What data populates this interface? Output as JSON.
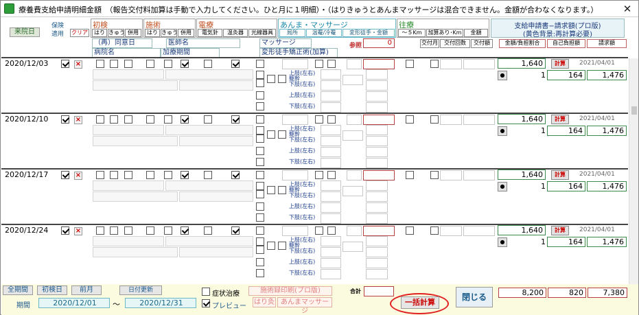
{
  "window": {
    "title": "療養費支給申請明細金額　（報告交付料加算は手動で入力してください。ひと月に１明細）・（はりきゅうとあんまマッサージは混合できません。金額が合わなくなります。）",
    "close": "✕",
    "icon": "app-icon"
  },
  "header": {
    "raiin_btn": "来院日",
    "hoken_lbl": "保険",
    "tekiyo_lbl": "適用",
    "clear_btn": "クリア",
    "shoken": {
      "title": "初検",
      "items": [
        "はり",
        "きゅう",
        "併用"
      ]
    },
    "seijutsu": {
      "title": "施術",
      "items": [
        "はり",
        "きゅう",
        "併用"
      ]
    },
    "denryo": {
      "title": "電療",
      "items": [
        "電気針",
        "温灸器",
        "光線器具"
      ]
    },
    "anma": {
      "title": "あんま・マッサージ",
      "items": [
        "局所",
        "温罨/冷罨",
        "変形徒手・金額"
      ]
    },
    "oushin": {
      "title": "往療",
      "items": [
        "～５Km",
        "加算あり･Km",
        "金額"
      ]
    },
    "shikyu": {
      "title": "支給申請書−請求額(プロ版)",
      "sub": "(黄色背景:再計算必要)"
    },
    "sub_row": {
      "sai": "（再）同意日",
      "ishi": "医師名",
      "massage": "マッサージ",
      "sanko": "参照",
      "sanko_val": "0",
      "kofu_tsuki": "交付月",
      "kofu_kaisu": "交付回数",
      "kofu_gaku": "交付額",
      "kingaku": "金額/負担割合",
      "jiko": "自己負担額",
      "seikyu": "請求額"
    },
    "third_row": {
      "byoin": "病院名",
      "kaso": "加療期間",
      "henkei": "変形徒手矯正術(加算)"
    }
  },
  "rows": [
    {
      "date": "2020/12/03",
      "total": "1,640",
      "calc": "計算",
      "sdate": "2021/04/01",
      "ratio": "1",
      "self": "164",
      "claim": "1,476"
    },
    {
      "date": "2020/12/10",
      "total": "1,640",
      "calc": "計算",
      "sdate": "2021/04/01",
      "ratio": "1",
      "self": "164",
      "claim": "1,476"
    },
    {
      "date": "2020/12/17",
      "total": "1,640",
      "calc": "計算",
      "sdate": "2021/04/01",
      "ratio": "1",
      "self": "164",
      "claim": "1,476"
    },
    {
      "date": "2020/12/24",
      "total": "1,640",
      "calc": "計算",
      "sdate": "2021/04/01",
      "ratio": "1",
      "self": "164",
      "claim": "1,476"
    }
  ],
  "body_labels": {
    "jousi": "上肢(左右)",
    "kantai": "躯幹",
    "kashi": "下肢(左右)"
  },
  "footer": {
    "all_period": "全期間",
    "first_day": "初検日",
    "prev_month": "前月",
    "date_update": "日付更新",
    "period_lbl": "期間",
    "from": "2020/12/01",
    "tilde": "～",
    "to": "2020/12/31",
    "shojo": "症状治療",
    "preview": "プレビュー",
    "print": "施術録印刷(プロ版)",
    "hari": "はり灸",
    "anma": "あんまマッサージ",
    "gokei": "合計",
    "ikkatsu": "一括計算",
    "close": "閉じる",
    "sum_total": "8,200",
    "sum_self": "820",
    "sum_claim": "7,380"
  },
  "colors": {
    "accent_red": "#c00000",
    "green_border": "#3c8a4a",
    "footer_bg": "#fbfbe0"
  }
}
